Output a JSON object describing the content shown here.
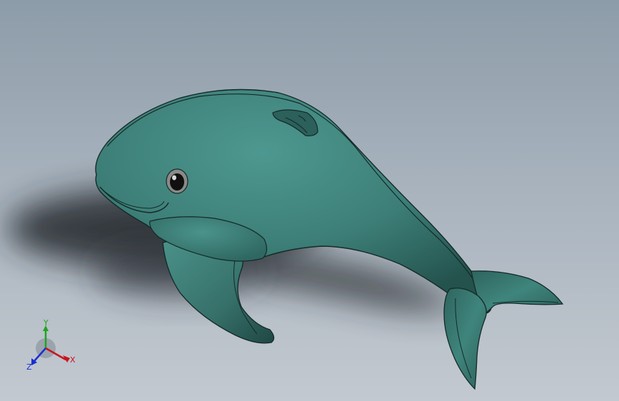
{
  "viewport": {
    "background_top": "#8d9ca9",
    "background_bottom": "#c3c9d0"
  },
  "model": {
    "body_color": "#3d7f78",
    "edge_color": "#142a28",
    "shadow_color": "#2a2f35"
  },
  "triad": {
    "x_label": "X",
    "y_label": "Y",
    "z_label": "Z",
    "x_color": "#c8141e",
    "y_color": "#1fa51f",
    "z_color": "#1a2fd0"
  }
}
